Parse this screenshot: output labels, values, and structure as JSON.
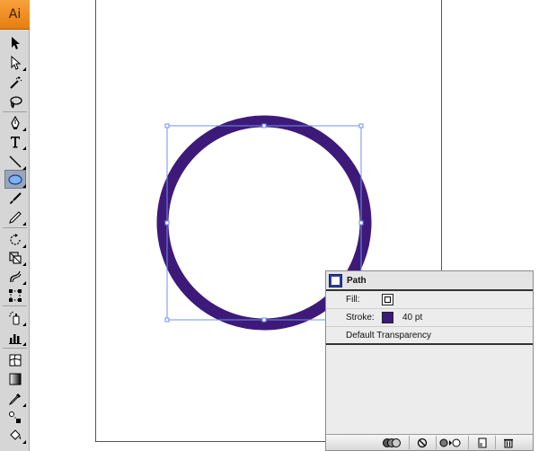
{
  "app": {
    "logo_text": "Ai",
    "logo_color": "#f08c1e"
  },
  "toolbox": {
    "selected_tool": "ellipse-tool",
    "tools": [
      "selection-tool",
      "direct-selection-tool",
      "magic-wand-tool",
      "lasso-tool",
      "pen-tool",
      "type-tool",
      "line-segment-tool",
      "ellipse-tool",
      "paintbrush-tool",
      "pencil-tool",
      "rotate-tool",
      "scale-tool",
      "warp-tool",
      "free-transform-tool",
      "symbol-sprayer-tool",
      "column-graph-tool",
      "mesh-tool",
      "gradient-tool",
      "eyedropper-tool",
      "blend-tool",
      "live-paint-bucket-tool"
    ]
  },
  "canvas": {
    "shape": "circle",
    "stroke_color": "#3d1a7a",
    "fill": "none",
    "selection_color": "#6f93e8"
  },
  "appearance_panel": {
    "object_type": "Path",
    "fill_label": "Fill:",
    "fill_value": "none",
    "stroke_label": "Stroke:",
    "stroke_color": "#3d1a7a",
    "stroke_weight": "40 pt",
    "transparency": "Default Transparency",
    "footer_buttons": [
      "new-art-basic-appearance",
      "clear-appearance",
      "reduce-to-basic",
      "duplicate-item",
      "delete-item"
    ]
  }
}
